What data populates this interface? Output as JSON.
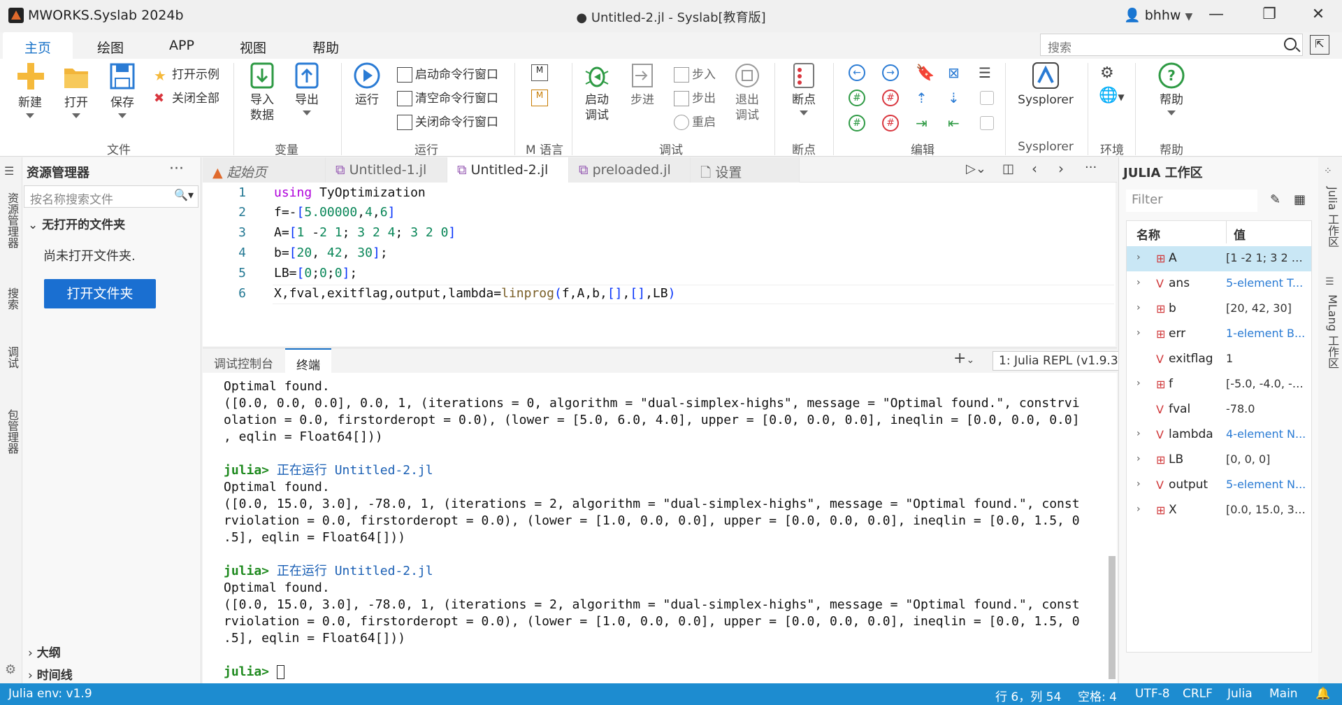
{
  "titlebar": {
    "app_name": "MWORKS.Syslab 2024b",
    "doc_title": "● Untitled-2.jl - Syslab[教育版]",
    "user": "bhhw"
  },
  "menu_tabs": [
    "主页",
    "绘图",
    "APP",
    "视图",
    "帮助"
  ],
  "search_placeholder": "搜索",
  "ribbon": {
    "file": {
      "new": "新建",
      "open": "打开",
      "save": "保存",
      "open_example": "打开示例",
      "close_all": "关闭全部",
      "group": "文件"
    },
    "variable": {
      "import_1": "导入",
      "import_2": "数据",
      "export": "导出",
      "group": "变量"
    },
    "run": {
      "run": "运行",
      "start_cmd": "启动命令行窗口",
      "clear_cmd": "清空命令行窗口",
      "close_cmd": "关闭命令行窗口",
      "group": "运行"
    },
    "mlang": {
      "group": "M 语言"
    },
    "debug": {
      "start_1": "启动",
      "start_2": "调试",
      "step": "步进",
      "step_in": "步入",
      "step_out": "步出",
      "restart": "重启",
      "exit_1": "退出",
      "exit_2": "调试",
      "group": "调试"
    },
    "breakpoint": {
      "label": "断点",
      "group": "断点"
    },
    "edit": {
      "group": "编辑"
    },
    "sysplorer": {
      "label": "Sysplorer",
      "group": "Sysplorer"
    },
    "env": {
      "group": "环境"
    },
    "help": {
      "label": "帮助",
      "group": "帮助"
    }
  },
  "activity_left": [
    "资源管理器",
    "搜索",
    "调试",
    "包管理器"
  ],
  "explorer": {
    "title": "资源管理器",
    "search_placeholder": "按名称搜索文件",
    "no_folder_section": "无打开的文件夹",
    "no_folder_msg": "尚未打开文件夹.",
    "open_folder_btn": "打开文件夹",
    "outline": "大纲",
    "timeline": "时间线"
  },
  "editor_tabs": [
    {
      "label": "起始页",
      "modified": false
    },
    {
      "label": "Untitled-1.jl",
      "modified": true
    },
    {
      "label": "Untitled-2.jl",
      "modified": true
    },
    {
      "label": "preloaded.jl",
      "modified": false
    },
    {
      "label": "设置",
      "modified": false
    }
  ],
  "code": {
    "line_numbers": [
      "1",
      "2",
      "3",
      "4",
      "5",
      "6"
    ],
    "l1_kw": "using",
    "l1_rest": " TyOptimization",
    "l2_a": "f=-",
    "l2_b": "[",
    "l2_c": "5.00000",
    "l2_d": ",",
    "l2_e": "4",
    "l2_f": ",",
    "l2_g": "6",
    "l2_h": "]",
    "l3_a": "A=",
    "l3_b": "[",
    "l3_c": "1",
    "l3_d": " -",
    "l3_e": "2",
    "l3_f": " ",
    "l3_g": "1",
    "l3_h": "; ",
    "l3_i": "3",
    "l3_j": " ",
    "l3_k": "2",
    "l3_l": " ",
    "l3_m": "4",
    "l3_n": "; ",
    "l3_o": "3",
    "l3_p": " ",
    "l3_q": "2",
    "l3_r": " ",
    "l3_s": "0",
    "l3_t": "]",
    "l4_a": "b=",
    "l4_b": "[",
    "l4_c": "20",
    "l4_d": ", ",
    "l4_e": "42",
    "l4_f": ", ",
    "l4_g": "30",
    "l4_h": "]",
    "l4_i": ";",
    "l5_a": "LB=",
    "l5_b": "[",
    "l5_c": "0",
    "l5_d": ";",
    "l5_e": "0",
    "l5_f": ";",
    "l5_g": "0",
    "l5_h": "]",
    "l5_i": ";",
    "l6_a": "X,fval,exitflag,output,lambda=",
    "l6_b": "linprog",
    "l6_c": "(",
    "l6_d": "f,A,b,",
    "l6_e": "[]",
    "l6_f": ",",
    "l6_g": "[]",
    "l6_h": ",LB",
    "l6_i": ")"
  },
  "panel": {
    "tab_debug": "调试控制台",
    "tab_terminal": "终端",
    "repl_select": "1: Julia REPL (v1.9.3)"
  },
  "terminal": {
    "block1": "Optimal found.\n([0.0, 0.0, 0.0], 0.0, 1, (iterations = 0, algorithm = \"dual-simplex-highs\", message = \"Optimal found.\", constrvi\nolation = 0.0, firstorderopt = 0.0), (lower = [5.0, 6.0, 4.0], upper = [0.0, 0.0, 0.0], ineqlin = [0.0, 0.0, 0.0]\n, eqlin = Float64[]))\n",
    "prompt": "julia>",
    "run_msg": " 正在运行 Untitled-2.jl",
    "block2": "Optimal found.\n([0.0, 15.0, 3.0], -78.0, 1, (iterations = 2, algorithm = \"dual-simplex-highs\", message = \"Optimal found.\", const\nrviolation = 0.0, firstorderopt = 0.0), (lower = [1.0, 0.0, 0.0], upper = [0.0, 0.0, 0.0], ineqlin = [0.0, 1.5, 0\n.5], eqlin = Float64[]))\n",
    "block3": "Optimal found.\n([0.0, 15.0, 3.0], -78.0, 1, (iterations = 2, algorithm = \"dual-simplex-highs\", message = \"Optimal found.\", const\nrviolation = 0.0, firstorderopt = 0.0), (lower = [1.0, 0.0, 0.0], upper = [0.0, 0.0, 0.0], ineqlin = [0.0, 1.5, 0\n.5], eqlin = Float64[]))\n"
  },
  "workspace": {
    "title": "JULIA 工作区",
    "filter_placeholder": "Filter",
    "col_name": "名称",
    "col_value": "值",
    "vars": [
      {
        "name": "A",
        "value": "[1 -2 1; 3 2 4...",
        "type": "matrix",
        "expandable": true,
        "link": false
      },
      {
        "name": "ans",
        "value": "5-element T...",
        "type": "var",
        "expandable": true,
        "link": true
      },
      {
        "name": "b",
        "value": "[20, 42, 30]",
        "type": "matrix",
        "expandable": true,
        "link": false
      },
      {
        "name": "err",
        "value": "1-element B...",
        "type": "matrix",
        "expandable": true,
        "link": true
      },
      {
        "name": "exitflag",
        "value": "1",
        "type": "var",
        "expandable": false,
        "link": false
      },
      {
        "name": "f",
        "value": "[-5.0, -4.0, -6...",
        "type": "matrix",
        "expandable": true,
        "link": false
      },
      {
        "name": "fval",
        "value": "-78.0",
        "type": "var",
        "expandable": false,
        "link": false
      },
      {
        "name": "lambda",
        "value": "4-element N...",
        "type": "var",
        "expandable": true,
        "link": true
      },
      {
        "name": "LB",
        "value": "[0, 0, 0]",
        "type": "matrix",
        "expandable": true,
        "link": false
      },
      {
        "name": "output",
        "value": "5-element N...",
        "type": "var",
        "expandable": true,
        "link": true
      },
      {
        "name": "X",
        "value": "[0.0, 15.0, 3.0]",
        "type": "matrix",
        "expandable": true,
        "link": false
      }
    ]
  },
  "activity_right": [
    "Julia 工作区",
    "MLang 工作区"
  ],
  "statusbar": {
    "env": "Julia env: v1.9",
    "position": "行 6，列 54",
    "spaces": "空格: 4",
    "encoding": "UTF-8",
    "eol": "CRLF",
    "language": "Julia",
    "branch": "Main"
  },
  "colors": {
    "accent": "#1a73c8",
    "status": "#1d8cd0",
    "open_button": "#1a6fd1",
    "selected_row": "#c9e7f5"
  }
}
